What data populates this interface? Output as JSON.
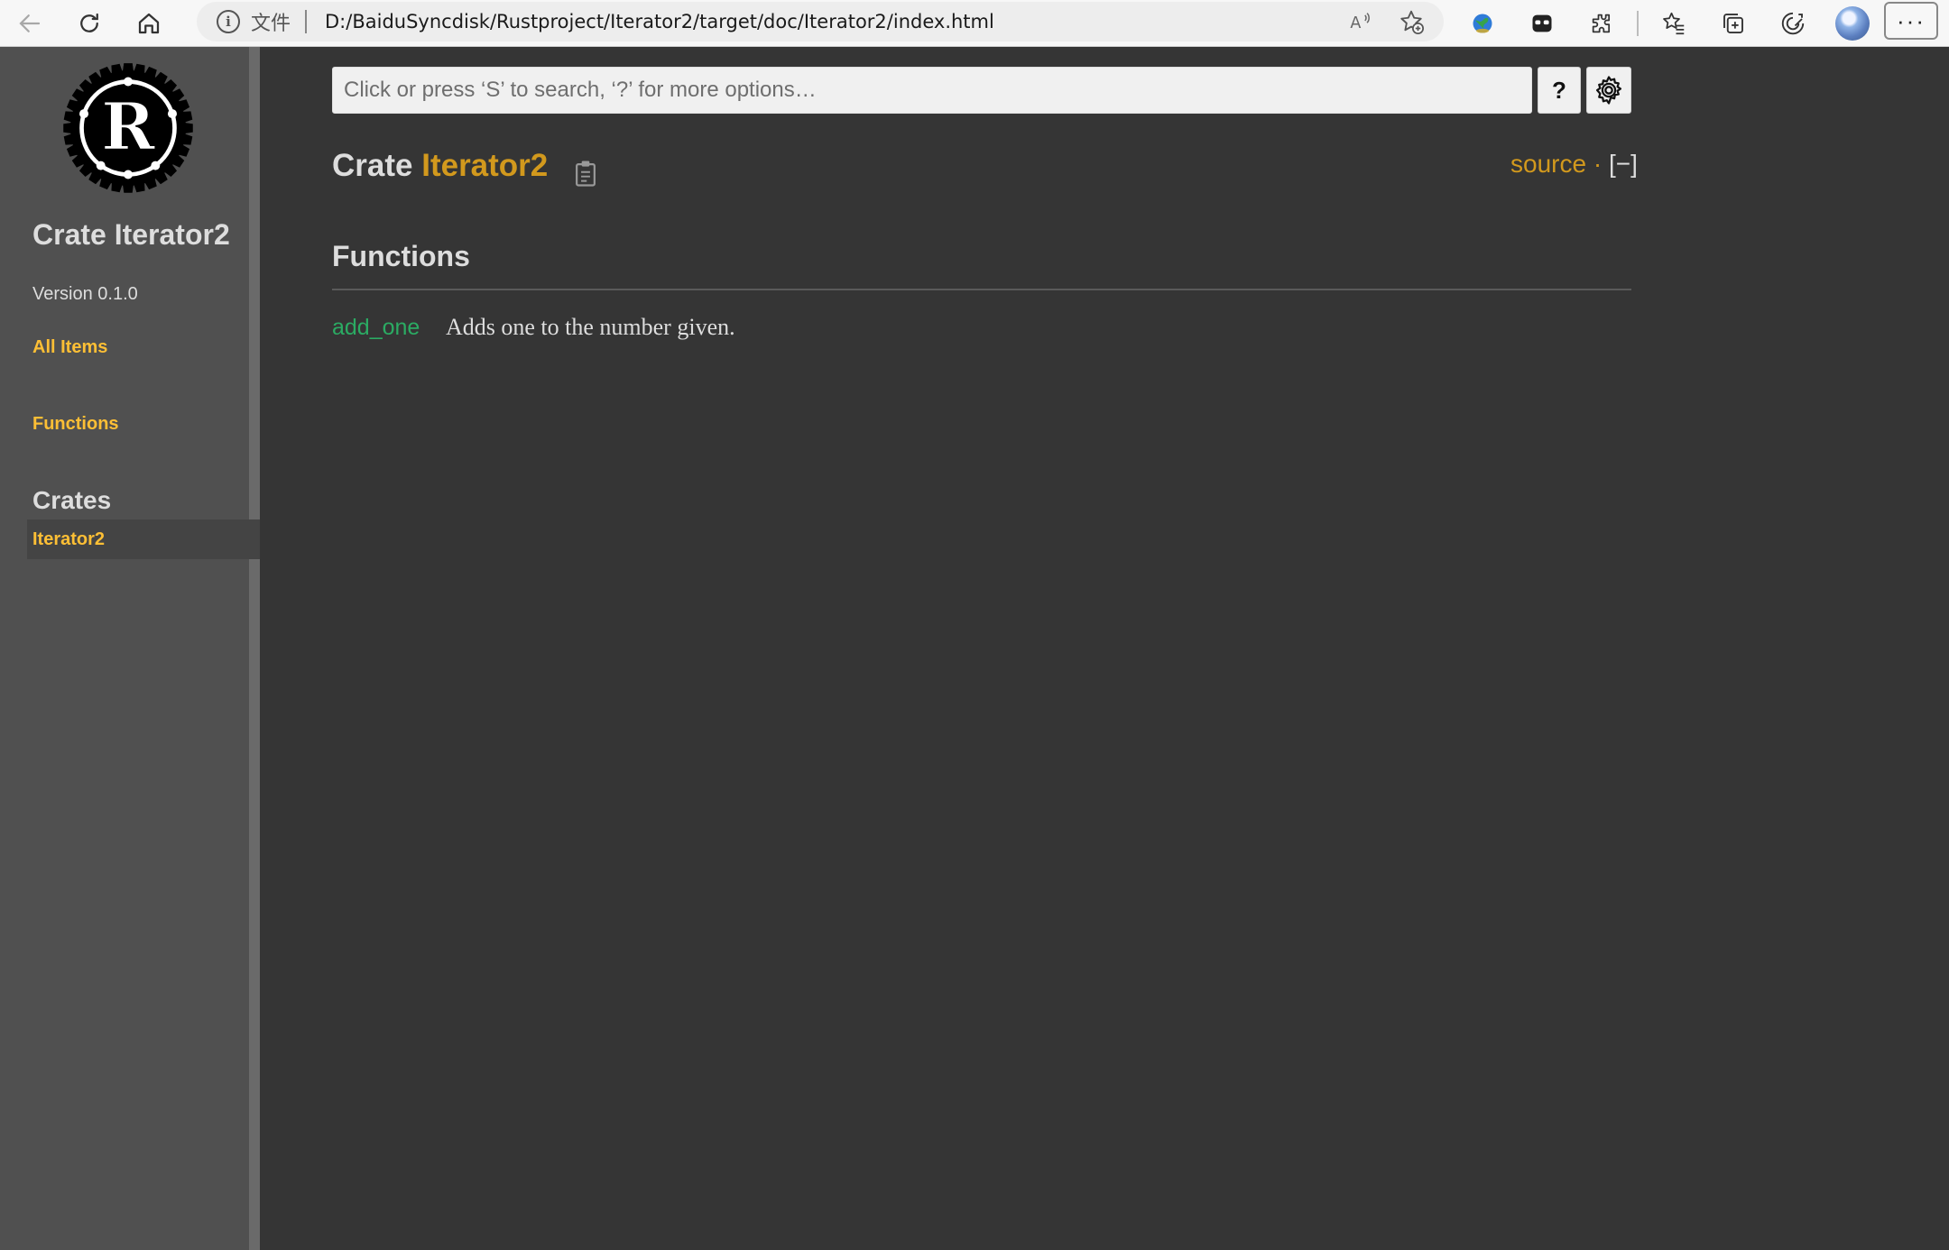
{
  "browser": {
    "address_scheme": "文件",
    "url": "D:/BaiduSyncdisk/Rustproject/Iterator2/target/doc/Iterator2/index.html",
    "menu_label": "···"
  },
  "sidebar": {
    "title": "Crate Iterator2",
    "version": "Version 0.1.0",
    "all_items": "All Items",
    "functions_link": "Functions",
    "crates_heading": "Crates",
    "current_crate": "Iterator2"
  },
  "search": {
    "placeholder": "Click or press ‘S’ to search, ‘?’ for more options…",
    "help_label": "?"
  },
  "header": {
    "crate_prefix": "Crate",
    "crate_name": "Iterator2",
    "source_label": "source",
    "separator": "·",
    "collapse_label": "[−]"
  },
  "functions_section": {
    "heading": "Functions",
    "items": [
      {
        "name": "add_one",
        "description": "Adds one to the number given."
      }
    ]
  },
  "colors": {
    "background": "#353535",
    "sidebar": "#505050",
    "crate_link": "#d2991d",
    "sidebar_link": "#fdbf35",
    "fn_link": "#2bab63",
    "text": "#dddddd"
  },
  "icons": [
    "back-icon",
    "refresh-icon",
    "home-icon",
    "info-icon",
    "read-aloud-icon",
    "favorite-add-icon",
    "extension-globe-icon",
    "extension-mask-icon",
    "extensions-puzzle-icon",
    "favorites-icon",
    "collections-icon",
    "performance-icon",
    "rust-logo-icon",
    "copy-path-icon",
    "gear-icon"
  ]
}
